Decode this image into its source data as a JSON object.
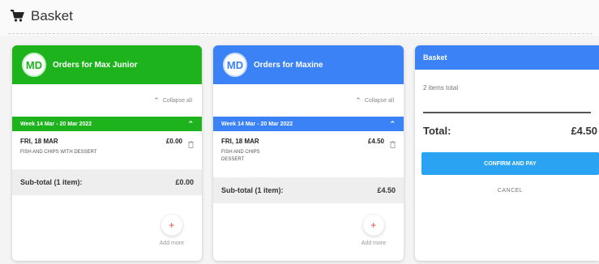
{
  "header": {
    "title": "Basket",
    "icon": "cart-icon"
  },
  "orders": [
    {
      "initials": "MD",
      "title": "Orders for Max Junior",
      "accent": "#1db31d",
      "collapse_label": "Collapse all",
      "week_label": "Week 14 Mar - 20 Mar 2022",
      "date": "FRI, 18 MAR",
      "price": "£0.00",
      "items": [
        "FISH AND CHIPS WITH DESSERT"
      ],
      "subtotal_label": "Sub-total (1 item):",
      "subtotal_value": "£0.00",
      "add_more_label": "Add more"
    },
    {
      "initials": "MD",
      "title": "Orders for Maxine",
      "accent": "#3b82f6",
      "collapse_label": "Collapse all",
      "week_label": "Week 14 Mar - 20 Mar 2022",
      "date": "FRI, 18 MAR",
      "price": "£4.50",
      "items": [
        "FISH AND CHIPS",
        "DESSERT"
      ],
      "subtotal_label": "Sub-total (1 item):",
      "subtotal_value": "£4.50",
      "add_more_label": "Add more"
    }
  ],
  "basket": {
    "title": "Basket",
    "items_total": "2 items total",
    "total_label": "Total:",
    "total_value": "£4.50",
    "confirm_label": "CONFIRM AND PAY",
    "cancel_label": "CANCEL",
    "accent": "#3b82f6",
    "confirm_color": "#29a3f2"
  }
}
